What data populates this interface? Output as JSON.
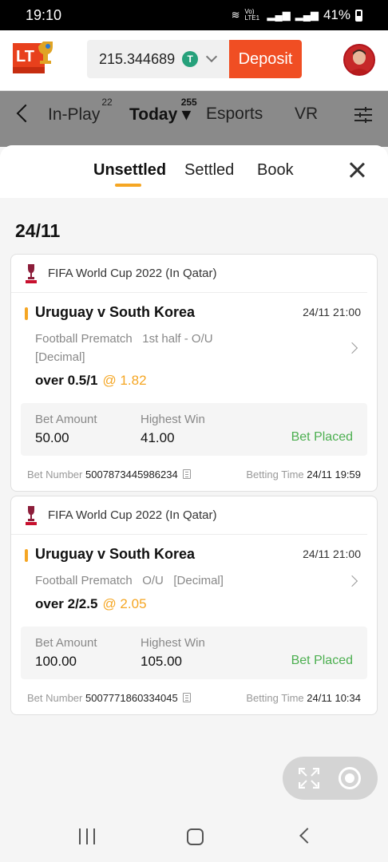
{
  "status_bar": {
    "time": "19:10",
    "network_label": "Vo) LTE1",
    "battery": "41%"
  },
  "header": {
    "logo_text": "LT",
    "balance": "215.344689",
    "currency_symbol": "T",
    "deposit_label": "Deposit"
  },
  "nav": {
    "items": [
      {
        "label": "In-Play",
        "count": "22"
      },
      {
        "label": "Today",
        "count": "255"
      },
      {
        "label": "Esports"
      },
      {
        "label": "VR"
      }
    ]
  },
  "sheet": {
    "tabs": [
      "Unsettled",
      "Settled",
      "Book"
    ],
    "active_tab": "Unsettled",
    "date_heading": "24/11"
  },
  "bets": [
    {
      "league": "FIFA World Cup 2022 (In Qatar)",
      "match": "Uruguay v South Korea",
      "match_time": "24/11 21:00",
      "market_line1": "Football Prematch   1st half - O/U",
      "market_line2": "[Decimal]",
      "pick": "over 0.5/1",
      "odds": "@ 1.82",
      "bet_amount_label": "Bet Amount",
      "bet_amount": "50.00",
      "highest_win_label": "Highest Win",
      "highest_win": "41.00",
      "status": "Bet Placed",
      "bet_number_label": "Bet Number",
      "bet_number": "5007873445986234",
      "betting_time_label": "Betting Time",
      "betting_time": "24/11 19:59"
    },
    {
      "league": "FIFA World Cup 2022 (In Qatar)",
      "match": "Uruguay v South Korea",
      "match_time": "24/11 21:00",
      "market_line1": "Football Prematch   O/U   [Decimal]",
      "pick": "over 2/2.5",
      "odds": "@ 2.05",
      "bet_amount_label": "Bet Amount",
      "bet_amount": "100.00",
      "highest_win_label": "Highest Win",
      "highest_win": "105.00",
      "status": "Bet Placed",
      "bet_number_label": "Bet Number",
      "bet_number": "5007771860334045",
      "betting_time_label": "Betting Time",
      "betting_time": "24/11 10:34"
    }
  ],
  "colors": {
    "accent_orange": "#f5a623",
    "deposit_red": "#f04e23",
    "status_green": "#4caf50",
    "tether_green": "#26a17b"
  }
}
